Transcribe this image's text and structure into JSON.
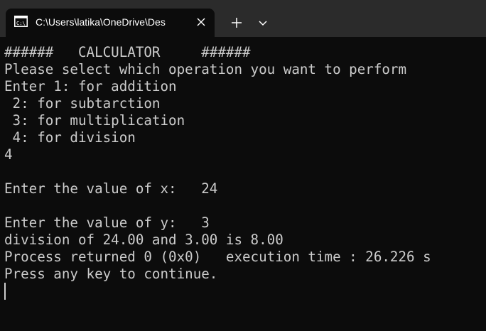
{
  "tab": {
    "title": "C:\\Users\\latika\\OneDrive\\Des",
    "icon": "command-prompt-icon",
    "close_icon": "close-icon"
  },
  "toolbar": {
    "new_tab_icon": "plus-icon",
    "dropdown_icon": "chevron-down-icon"
  },
  "terminal": {
    "lines": [
      "######   CALCULATOR     ######",
      "Please select which operation you want to perform",
      "Enter 1: for addition",
      " 2: for subtarction",
      " 3: for multiplication",
      " 4: for division",
      "4",
      "",
      "Enter the value of x:   24",
      "",
      "Enter the value of y:   3",
      "division of 24.00 and 3.00 is 8.00",
      "Process returned 0 (0x0)   execution time : 26.226 s",
      "Press any key to continue."
    ]
  },
  "colors": {
    "background": "#0c0c0c",
    "titlebar": "#2b2b2b",
    "foreground": "#cccccc"
  }
}
